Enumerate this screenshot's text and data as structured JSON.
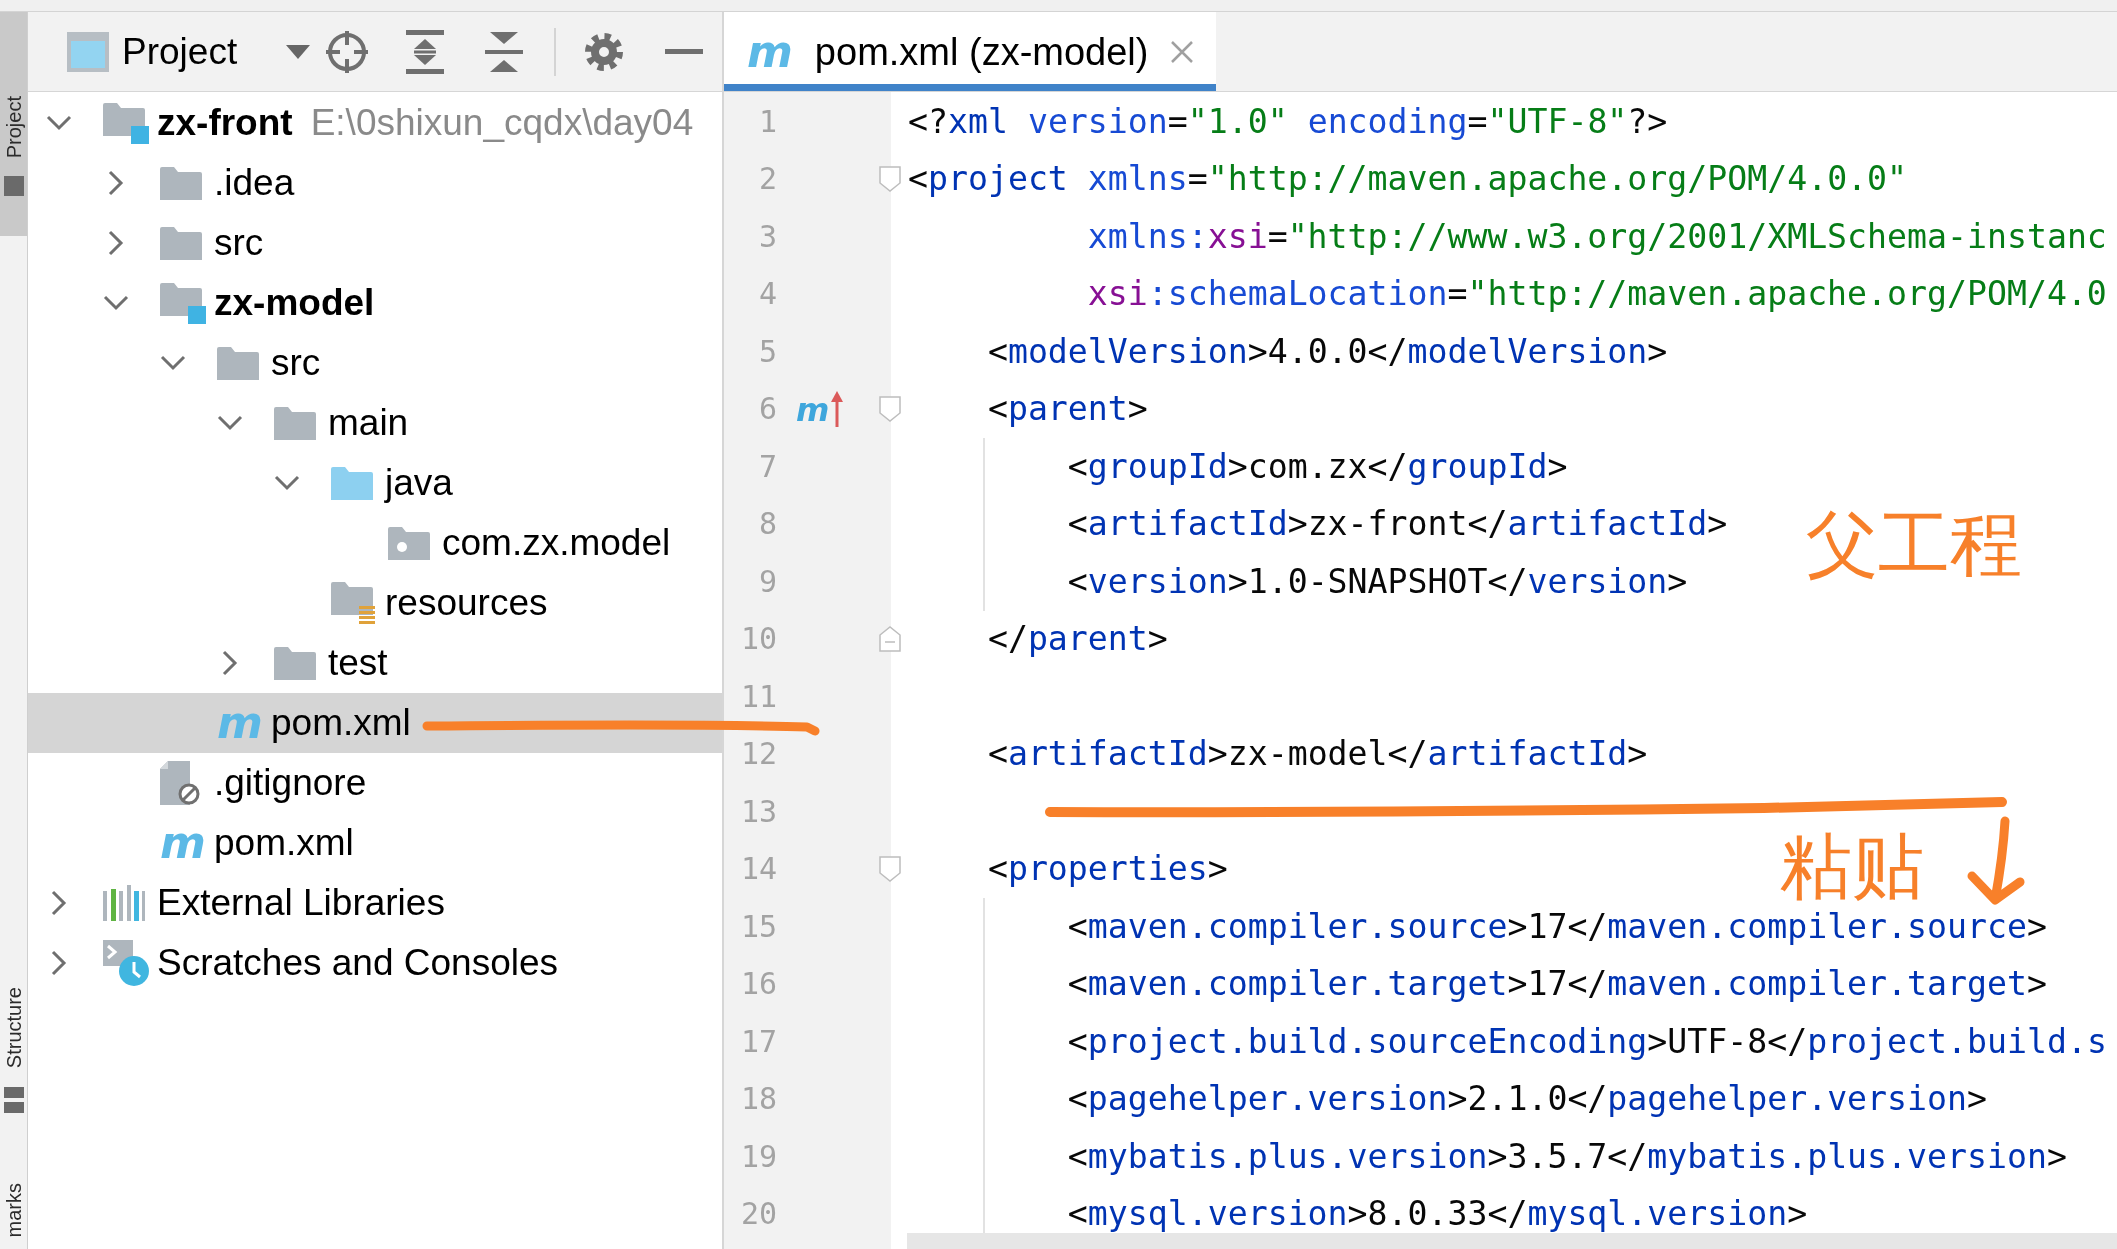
{
  "tool_strip": {
    "tabs": [
      {
        "label": "Project",
        "kind": "project",
        "selected": true
      },
      {
        "label": "Structure",
        "kind": "structure",
        "selected": false
      },
      {
        "label": "marks",
        "kind": "plain",
        "selected": false
      }
    ]
  },
  "project_panel": {
    "title": "Project",
    "tree": [
      {
        "label": "zx-front",
        "kind": "module",
        "path": "E:\\0shixun_cqdx\\day04",
        "expanded": true,
        "selected": false,
        "children": [
          {
            "label": ".idea",
            "kind": "folder",
            "expanded": false,
            "selected": false
          },
          {
            "label": "src",
            "kind": "folder",
            "expanded": false,
            "selected": false
          },
          {
            "label": "zx-model",
            "kind": "module",
            "expanded": true,
            "selected": false,
            "children": [
              {
                "label": "src",
                "kind": "folder",
                "expanded": true,
                "selected": false,
                "children": [
                  {
                    "label": "main",
                    "kind": "folder",
                    "expanded": true,
                    "selected": false,
                    "children": [
                      {
                        "label": "java",
                        "kind": "source-folder",
                        "expanded": true,
                        "selected": false,
                        "children": [
                          {
                            "label": "com.zx.model",
                            "kind": "package",
                            "selected": false
                          }
                        ]
                      },
                      {
                        "label": "resources",
                        "kind": "resources-folder",
                        "selected": false
                      }
                    ]
                  },
                  {
                    "label": "test",
                    "kind": "folder",
                    "expanded": false,
                    "selected": false
                  }
                ]
              },
              {
                "label": "pom.xml",
                "kind": "maven-file",
                "icon_text": "m",
                "selected": true
              }
            ]
          },
          {
            "label": ".gitignore",
            "kind": "ignore-file",
            "selected": false
          },
          {
            "label": "pom.xml",
            "kind": "maven-file",
            "icon_text": "m",
            "selected": false
          }
        ]
      },
      {
        "label": "External Libraries",
        "kind": "libraries",
        "expanded": false,
        "selected": false
      },
      {
        "label": "Scratches and Consoles",
        "kind": "scratches",
        "expanded": false,
        "selected": false
      }
    ]
  },
  "editor": {
    "tabs": [
      {
        "label": "pom.xml (zx-model)",
        "icon_text": "m",
        "selected": true
      }
    ],
    "lines": [
      {
        "number": "1",
        "tokens": [
          {
            "kind": "punct",
            "text": "<?"
          },
          {
            "kind": "tag",
            "text": "xml"
          },
          {
            "kind": "attr",
            "text": " version"
          },
          {
            "kind": "punct",
            "text": "="
          },
          {
            "kind": "string",
            "text": "\"1.0\""
          },
          {
            "kind": "attr",
            "text": " encoding"
          },
          {
            "kind": "punct",
            "text": "="
          },
          {
            "kind": "string",
            "text": "\"UTF-8\""
          },
          {
            "kind": "punct",
            "text": "?>"
          }
        ]
      },
      {
        "number": "2",
        "tokens": [
          {
            "kind": "punct",
            "text": "<"
          },
          {
            "kind": "tag",
            "text": "project"
          },
          {
            "kind": "attr",
            "text": " xmlns"
          },
          {
            "kind": "punct",
            "text": "="
          },
          {
            "kind": "string",
            "text": "\"http://maven.apache.org/POM/4.0.0\""
          }
        ],
        "continued": [
          {
            "number": "3",
            "tokens": [
              {
                "kind": "attr",
                "text": "xmlns:"
              },
              {
                "kind": "ns",
                "text": "xsi"
              },
              {
                "kind": "punct",
                "text": "="
              },
              {
                "kind": "string",
                "text": "\"http://www.w3.org/2001/XMLSchema-instanc"
              }
            ]
          },
          {
            "number": "4",
            "tokens": [
              {
                "kind": "ns",
                "text": "xsi"
              },
              {
                "kind": "attr",
                "text": ":schemaLocation"
              },
              {
                "kind": "punct",
                "text": "="
              },
              {
                "kind": "string",
                "text": "\"http://maven.apache.org/POM/4.0"
              }
            ]
          }
        ],
        "children": [
          {
            "number": "5",
            "tokens": [
              {
                "kind": "punct",
                "text": "<"
              },
              {
                "kind": "tag",
                "text": "modelVersion"
              },
              {
                "kind": "punct",
                "text": ">"
              },
              {
                "kind": "text",
                "text": "4.0.0"
              },
              {
                "kind": "punct",
                "text": "</"
              },
              {
                "kind": "tag",
                "text": "modelVersion"
              },
              {
                "kind": "punct",
                "text": ">"
              }
            ]
          },
          {
            "number": "6",
            "gutter_mark": "m",
            "tokens": [
              {
                "kind": "punct",
                "text": "<"
              },
              {
                "kind": "tag",
                "text": "parent"
              },
              {
                "kind": "punct",
                "text": ">"
              }
            ],
            "children": [
              {
                "number": "7",
                "tokens": [
                  {
                    "kind": "punct",
                    "text": "<"
                  },
                  {
                    "kind": "tag",
                    "text": "groupId"
                  },
                  {
                    "kind": "punct",
                    "text": ">"
                  },
                  {
                    "kind": "text",
                    "text": "com.zx"
                  },
                  {
                    "kind": "punct",
                    "text": "</"
                  },
                  {
                    "kind": "tag",
                    "text": "groupId"
                  },
                  {
                    "kind": "punct",
                    "text": ">"
                  }
                ]
              },
              {
                "number": "8",
                "tokens": [
                  {
                    "kind": "punct",
                    "text": "<"
                  },
                  {
                    "kind": "tag",
                    "text": "artifactId"
                  },
                  {
                    "kind": "punct",
                    "text": ">"
                  },
                  {
                    "kind": "text",
                    "text": "zx-front"
                  },
                  {
                    "kind": "punct",
                    "text": "</"
                  },
                  {
                    "kind": "tag",
                    "text": "artifactId"
                  },
                  {
                    "kind": "punct",
                    "text": ">"
                  }
                ]
              },
              {
                "number": "9",
                "tokens": [
                  {
                    "kind": "punct",
                    "text": "<"
                  },
                  {
                    "kind": "tag",
                    "text": "version"
                  },
                  {
                    "kind": "punct",
                    "text": ">"
                  },
                  {
                    "kind": "text",
                    "text": "1.0-SNAPSHOT"
                  },
                  {
                    "kind": "punct",
                    "text": "</"
                  },
                  {
                    "kind": "tag",
                    "text": "version"
                  },
                  {
                    "kind": "punct",
                    "text": ">"
                  }
                ]
              }
            ],
            "closing": {
              "number": "10",
              "tokens": [
                {
                  "kind": "punct",
                  "text": "</"
                },
                {
                  "kind": "tag",
                  "text": "parent"
                },
                {
                  "kind": "punct",
                  "text": ">"
                }
              ]
            }
          },
          {
            "number": "11"
          },
          {
            "number": "12",
            "tokens": [
              {
                "kind": "punct",
                "text": "<"
              },
              {
                "kind": "tag",
                "text": "artifactId"
              },
              {
                "kind": "punct",
                "text": ">"
              },
              {
                "kind": "text",
                "text": "zx-model"
              },
              {
                "kind": "punct",
                "text": "</"
              },
              {
                "kind": "tag",
                "text": "artifactId"
              },
              {
                "kind": "punct",
                "text": ">"
              }
            ]
          },
          {
            "number": "13"
          },
          {
            "number": "14",
            "tokens": [
              {
                "kind": "punct",
                "text": "<"
              },
              {
                "kind": "tag",
                "text": "properties"
              },
              {
                "kind": "punct",
                "text": ">"
              }
            ],
            "children": [
              {
                "number": "15",
                "tokens": [
                  {
                    "kind": "punct",
                    "text": "<"
                  },
                  {
                    "kind": "tag",
                    "text": "maven.compiler.source"
                  },
                  {
                    "kind": "punct",
                    "text": ">"
                  },
                  {
                    "kind": "text",
                    "text": "17"
                  },
                  {
                    "kind": "punct",
                    "text": "</"
                  },
                  {
                    "kind": "tag",
                    "text": "maven.compiler.source"
                  },
                  {
                    "kind": "punct",
                    "text": ">"
                  }
                ]
              },
              {
                "number": "16",
                "tokens": [
                  {
                    "kind": "punct",
                    "text": "<"
                  },
                  {
                    "kind": "tag",
                    "text": "maven.compiler.target"
                  },
                  {
                    "kind": "punct",
                    "text": ">"
                  },
                  {
                    "kind": "text",
                    "text": "17"
                  },
                  {
                    "kind": "punct",
                    "text": "</"
                  },
                  {
                    "kind": "tag",
                    "text": "maven.compiler.target"
                  },
                  {
                    "kind": "punct",
                    "text": ">"
                  }
                ]
              },
              {
                "number": "17",
                "tokens": [
                  {
                    "kind": "punct",
                    "text": "<"
                  },
                  {
                    "kind": "tag",
                    "text": "project.build.sourceEncoding"
                  },
                  {
                    "kind": "punct",
                    "text": ">"
                  },
                  {
                    "kind": "text",
                    "text": "UTF-8"
                  },
                  {
                    "kind": "punct",
                    "text": "</"
                  },
                  {
                    "kind": "tag",
                    "text": "project.build.s"
                  }
                ]
              },
              {
                "number": "18",
                "tokens": [
                  {
                    "kind": "punct",
                    "text": "<"
                  },
                  {
                    "kind": "tag",
                    "text": "pagehelper.version"
                  },
                  {
                    "kind": "punct",
                    "text": ">"
                  },
                  {
                    "kind": "text",
                    "text": "2.1.0"
                  },
                  {
                    "kind": "punct",
                    "text": "</"
                  },
                  {
                    "kind": "tag",
                    "text": "pagehelper.version"
                  },
                  {
                    "kind": "punct",
                    "text": ">"
                  }
                ]
              },
              {
                "number": "19",
                "tokens": [
                  {
                    "kind": "punct",
                    "text": "<"
                  },
                  {
                    "kind": "tag",
                    "text": "mybatis.plus.version"
                  },
                  {
                    "kind": "punct",
                    "text": ">"
                  },
                  {
                    "kind": "text",
                    "text": "3.5.7"
                  },
                  {
                    "kind": "punct",
                    "text": "</"
                  },
                  {
                    "kind": "tag",
                    "text": "mybatis.plus.version"
                  },
                  {
                    "kind": "punct",
                    "text": ">"
                  }
                ]
              },
              {
                "number": "20",
                "tokens": [
                  {
                    "kind": "punct",
                    "text": "<"
                  },
                  {
                    "kind": "tag",
                    "text": "mysql.version"
                  },
                  {
                    "kind": "punct",
                    "text": ">"
                  },
                  {
                    "kind": "text",
                    "text": "8.0.33"
                  },
                  {
                    "kind": "punct",
                    "text": "</"
                  },
                  {
                    "kind": "tag",
                    "text": "mysql.version"
                  },
                  {
                    "kind": "punct",
                    "text": ">"
                  }
                ]
              }
            ]
          }
        ]
      }
    ]
  },
  "annotations": [
    {
      "kind": "underline"
    },
    {
      "kind": "label",
      "text": "父工程"
    },
    {
      "kind": "underline"
    },
    {
      "kind": "label",
      "text": "粘贴"
    },
    {
      "kind": "arrow"
    }
  ]
}
